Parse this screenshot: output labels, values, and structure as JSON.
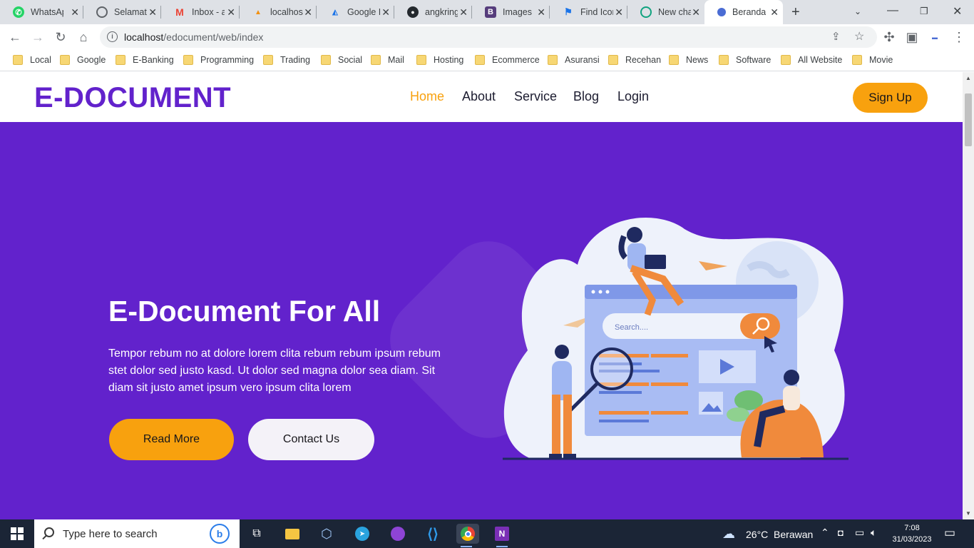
{
  "browser": {
    "tabs": [
      {
        "title": "WhatsApp",
        "icon": "whatsapp-icon",
        "color": "#25d366"
      },
      {
        "title": "Selamat",
        "icon": "globe-icon",
        "color": "#5f6368"
      },
      {
        "title": "Inbox - a",
        "icon": "gmail-icon",
        "color": "#ea4335"
      },
      {
        "title": "localhost",
        "icon": "phpmyadmin-icon",
        "color": "#f29111"
      },
      {
        "title": "Google I",
        "icon": "google-drive-icon",
        "color": "#1a73e8"
      },
      {
        "title": "angkring",
        "icon": "github-icon",
        "color": "#24292e"
      },
      {
        "title": "Images",
        "icon": "bootstrap-icon",
        "color": "#563d7c"
      },
      {
        "title": "Find Icon",
        "icon": "flag-icon",
        "color": "#1a73e8"
      },
      {
        "title": "New cha",
        "icon": "chatgpt-icon",
        "color": "#10a37f"
      },
      {
        "title": "Beranda",
        "icon": "site-icon",
        "color": "#4a6cd4",
        "active": true
      }
    ],
    "address": {
      "host": "localhost",
      "path": "/edocument/web/index"
    },
    "bookmarks": [
      "Local",
      "Google",
      "E-Banking",
      "Programming",
      "Trading",
      "Social",
      "Mail",
      "Hosting",
      "Ecommerce",
      "Asuransi",
      "Recehan",
      "News",
      "Software",
      "All Website",
      "Movie"
    ]
  },
  "site": {
    "logo": "E-DOCUMENT",
    "nav": [
      {
        "label": "Home",
        "active": true
      },
      {
        "label": "About"
      },
      {
        "label": "Service"
      },
      {
        "label": "Blog"
      },
      {
        "label": "Login"
      }
    ],
    "signup": "Sign Up",
    "hero": {
      "title": "E-Document For All",
      "text": "Tempor rebum no at dolore lorem clita rebum rebum ipsum rebum stet dolor sed justo kasd. Ut dolor sed magna dolor sea diam. Sit diam sit justo amet ipsum vero ipsum clita lorem",
      "read_more": "Read More",
      "contact": "Contact Us",
      "search_placeholder": "Search...."
    },
    "colors": {
      "brand": "#6222cc",
      "accent": "#f8a10e"
    }
  },
  "taskbar": {
    "search_placeholder": "Type here to search",
    "weather": "26°C  Berawan",
    "time": "7:08",
    "date": "31/03/2023"
  }
}
